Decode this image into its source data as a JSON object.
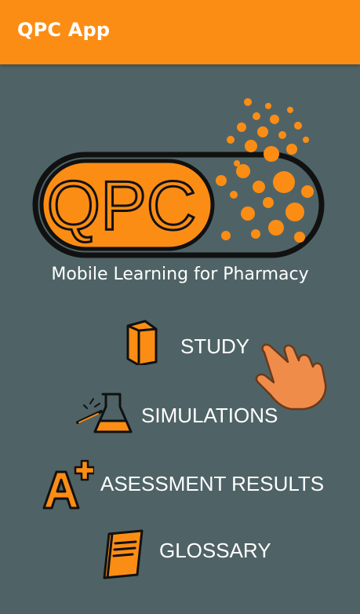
{
  "app_bar": {
    "title": "QPC App",
    "color": "#fc8d14"
  },
  "logo": {
    "text": "QPC",
    "tagline": "Mobile Learning for Pharmacy"
  },
  "menu": {
    "items": [
      {
        "label": "STUDY",
        "icon": "book-icon"
      },
      {
        "label": "SIMULATIONS",
        "icon": "flask-icon"
      },
      {
        "label": "ASESSMENT RESULTS",
        "icon": "a-plus-grade-icon"
      },
      {
        "label": "GLOSSARY",
        "icon": "notebook-icon"
      }
    ]
  },
  "colors": {
    "background": "#4f6366",
    "accent": "#fc8d14",
    "outline": "#111111",
    "text": "#ffffff"
  }
}
